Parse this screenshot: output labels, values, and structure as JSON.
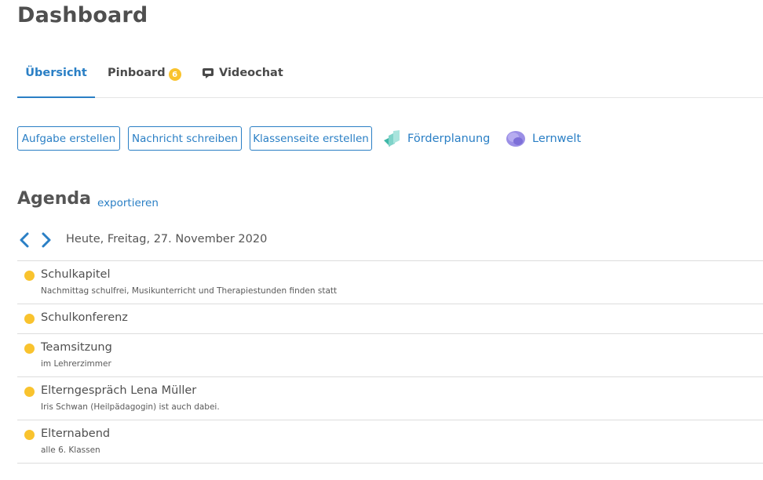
{
  "page": {
    "title": "Dashboard"
  },
  "tabs": [
    {
      "label": "Übersicht",
      "active": true
    },
    {
      "label": "Pinboard",
      "badge": "6"
    },
    {
      "label": "Videochat",
      "icon": "chat-bubble-icon"
    }
  ],
  "actions": {
    "create_task": "Aufgabe erstellen",
    "write_message": "Nachricht schreiben",
    "create_class_page": "Klassenseite erstellen",
    "foerderplanung": {
      "label": "Förderplanung",
      "icon": "foerderplanung-icon"
    },
    "lernwelt": {
      "label": "Lernwelt",
      "icon": "lernwelt-icon"
    }
  },
  "agenda": {
    "title": "Agenda",
    "export_label": "exportieren",
    "date_label": "Heute, Freitag, 27. November 2020",
    "items": [
      {
        "title": "Schulkapitel",
        "subtitle": "Nachmittag schulfrei, Musikunterricht und Therapiestunden finden statt"
      },
      {
        "title": "Schulkonferenz",
        "subtitle": ""
      },
      {
        "title": "Teamsitzung",
        "subtitle": "im Lehrerzimmer"
      },
      {
        "title": "Elterngespräch Lena Müller",
        "subtitle": "Iris Schwan (Heilpädagogin) ist auch dabei."
      },
      {
        "title": "Elternabend",
        "subtitle": "alle 6. Klassen"
      }
    ]
  },
  "colors": {
    "accent": "#2a7fc5",
    "badge": "#f9c32e",
    "event_dot": "#f9c32e",
    "divider": "#dcdcdc"
  }
}
